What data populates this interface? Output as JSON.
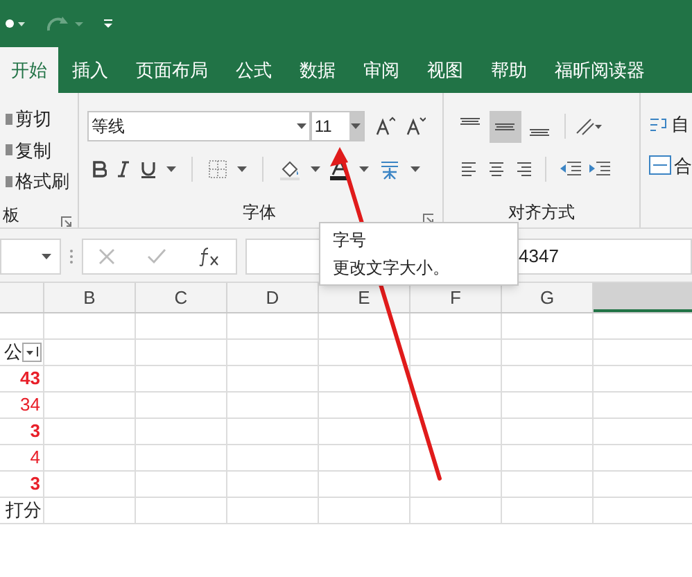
{
  "tabs": [
    {
      "label": "开始",
      "selected": true
    },
    {
      "label": "插入",
      "selected": false
    },
    {
      "label": "页面布局",
      "selected": false
    },
    {
      "label": "公式",
      "selected": false
    },
    {
      "label": "数据",
      "selected": false
    },
    {
      "label": "审阅",
      "selected": false
    },
    {
      "label": "视图",
      "selected": false
    },
    {
      "label": "帮助",
      "selected": false
    },
    {
      "label": "福昕阅读器",
      "selected": false
    }
  ],
  "clipboard": {
    "buttons": [
      "剪切",
      "复制",
      "格式刷"
    ],
    "group_label": "板"
  },
  "font": {
    "name": "等线",
    "size": "11",
    "group_label": "字体"
  },
  "alignment": {
    "vertical": [
      {
        "selected": false
      },
      {
        "selected": true
      },
      {
        "selected": false
      }
    ],
    "group_label": "对齐方式",
    "wrap_label": "自",
    "merge_label": "合"
  },
  "formula_bar": {
    "value": "4347"
  },
  "tooltip": {
    "title": "字号",
    "description": "更改文字大小。"
  },
  "columns": [
    "B",
    "C",
    "D",
    "E",
    "F",
    "G"
  ],
  "cells": [
    {
      "text": "",
      "kind": "empty"
    },
    {
      "text": "公",
      "kind": "header",
      "bold": false
    },
    {
      "text": "43",
      "kind": "number",
      "bold": true
    },
    {
      "text": "34",
      "kind": "number",
      "bold": false
    },
    {
      "text": "3",
      "kind": "number",
      "bold": true
    },
    {
      "text": "4",
      "kind": "number",
      "bold": false
    },
    {
      "text": "3",
      "kind": "number",
      "bold": true
    },
    {
      "text": "打分",
      "kind": "text",
      "bold": false
    }
  ]
}
